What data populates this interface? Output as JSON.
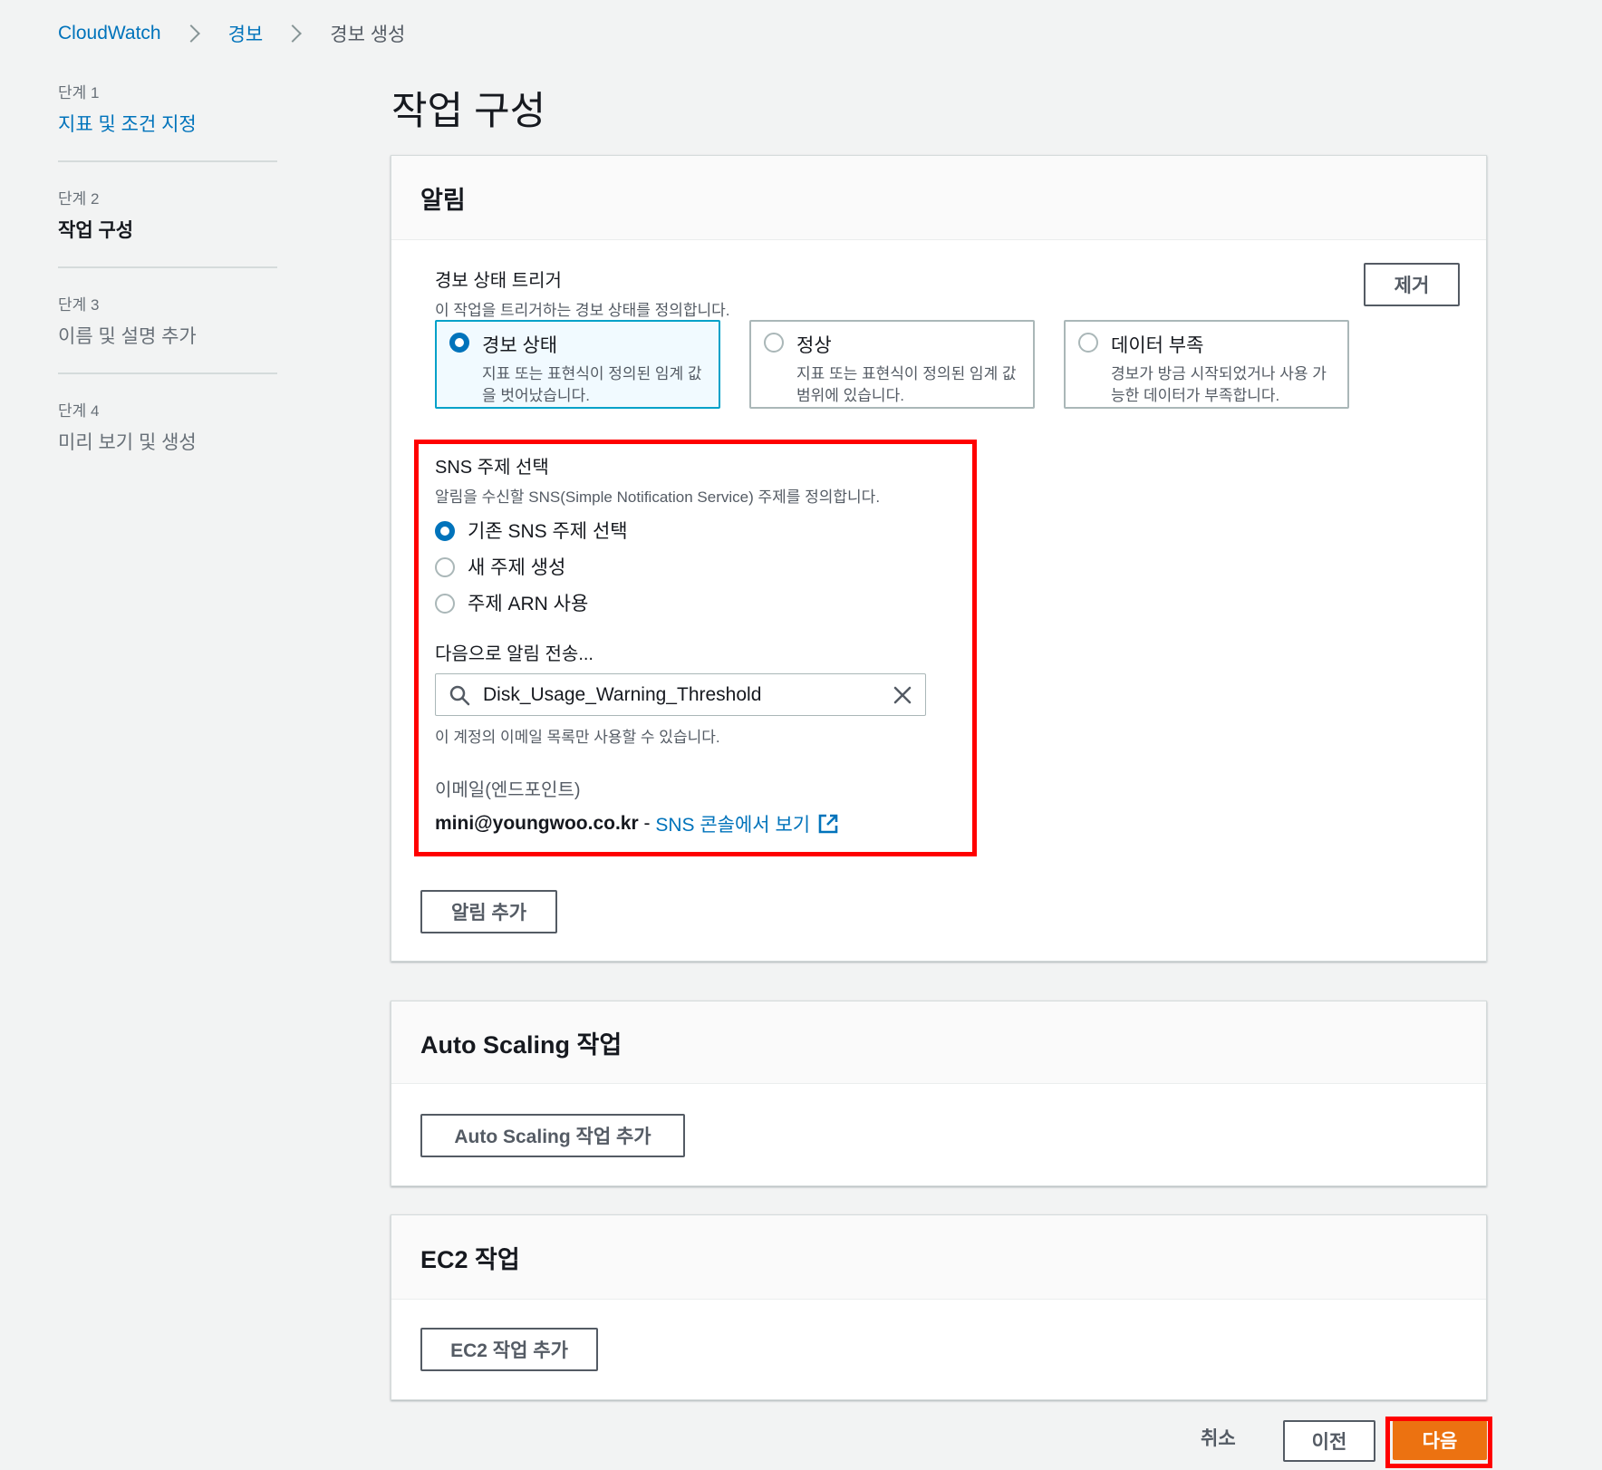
{
  "breadcrumb": [
    "CloudWatch",
    "경보",
    "경보 생성"
  ],
  "steps": [
    {
      "num": "단계 1",
      "label": "지표 및 조건 지정"
    },
    {
      "num": "단계 2",
      "label": "작업 구성"
    },
    {
      "num": "단계 3",
      "label": "이름 및 설명 추가"
    },
    {
      "num": "단계 4",
      "label": "미리 보기 및 생성"
    }
  ],
  "page_title": "작업 구성",
  "notification": {
    "title": "알림",
    "trigger_label": "경보 상태 트리거",
    "trigger_desc": "이 작업을 트리거하는 경보 상태를 정의합니다.",
    "remove_button": "제거",
    "states": [
      {
        "title": "경보 상태",
        "desc": "지표 또는 표현식이 정의된 임계 값을 벗어났습니다.",
        "selected": true
      },
      {
        "title": "정상",
        "desc": "지표 또는 표현식이 정의된 임계 값 범위에 있습니다.",
        "selected": false
      },
      {
        "title": "데이터 부족",
        "desc": "경보가 방금 시작되었거나 사용 가능한 데이터가 부족합니다.",
        "selected": false
      }
    ],
    "sns_label": "SNS 주제 선택",
    "sns_desc": "알림을 수신할 SNS(Simple Notification Service) 주제를 정의합니다.",
    "sns_options": [
      {
        "label": "기존 SNS 주제 선택",
        "selected": true
      },
      {
        "label": "새 주제 생성",
        "selected": false
      },
      {
        "label": "주제 ARN 사용",
        "selected": false
      }
    ],
    "send_to_label": "다음으로 알림 전송...",
    "topic_value": "Disk_Usage_Warning_Threshold",
    "email_hint": "이 계정의 이메일 목록만 사용할 수 있습니다.",
    "email_label": "이메일(엔드포인트)",
    "email_value": "mini@youngwoo.co.kr",
    "email_sep": " - ",
    "sns_console_link": "SNS 콘솔에서 보기",
    "add_button": "알림 추가"
  },
  "autoscaling": {
    "title": "Auto Scaling 작업",
    "add_button": "Auto Scaling 작업 추가"
  },
  "ec2": {
    "title": "EC2 작업",
    "add_button": "EC2 작업 추가"
  },
  "footer": {
    "cancel": "취소",
    "previous": "이전",
    "next": "다음"
  },
  "colors": {
    "link": "#0073bb",
    "primary": "#ec7211",
    "highlight": "#ff0000",
    "selected_tile": "#00a1c9"
  }
}
